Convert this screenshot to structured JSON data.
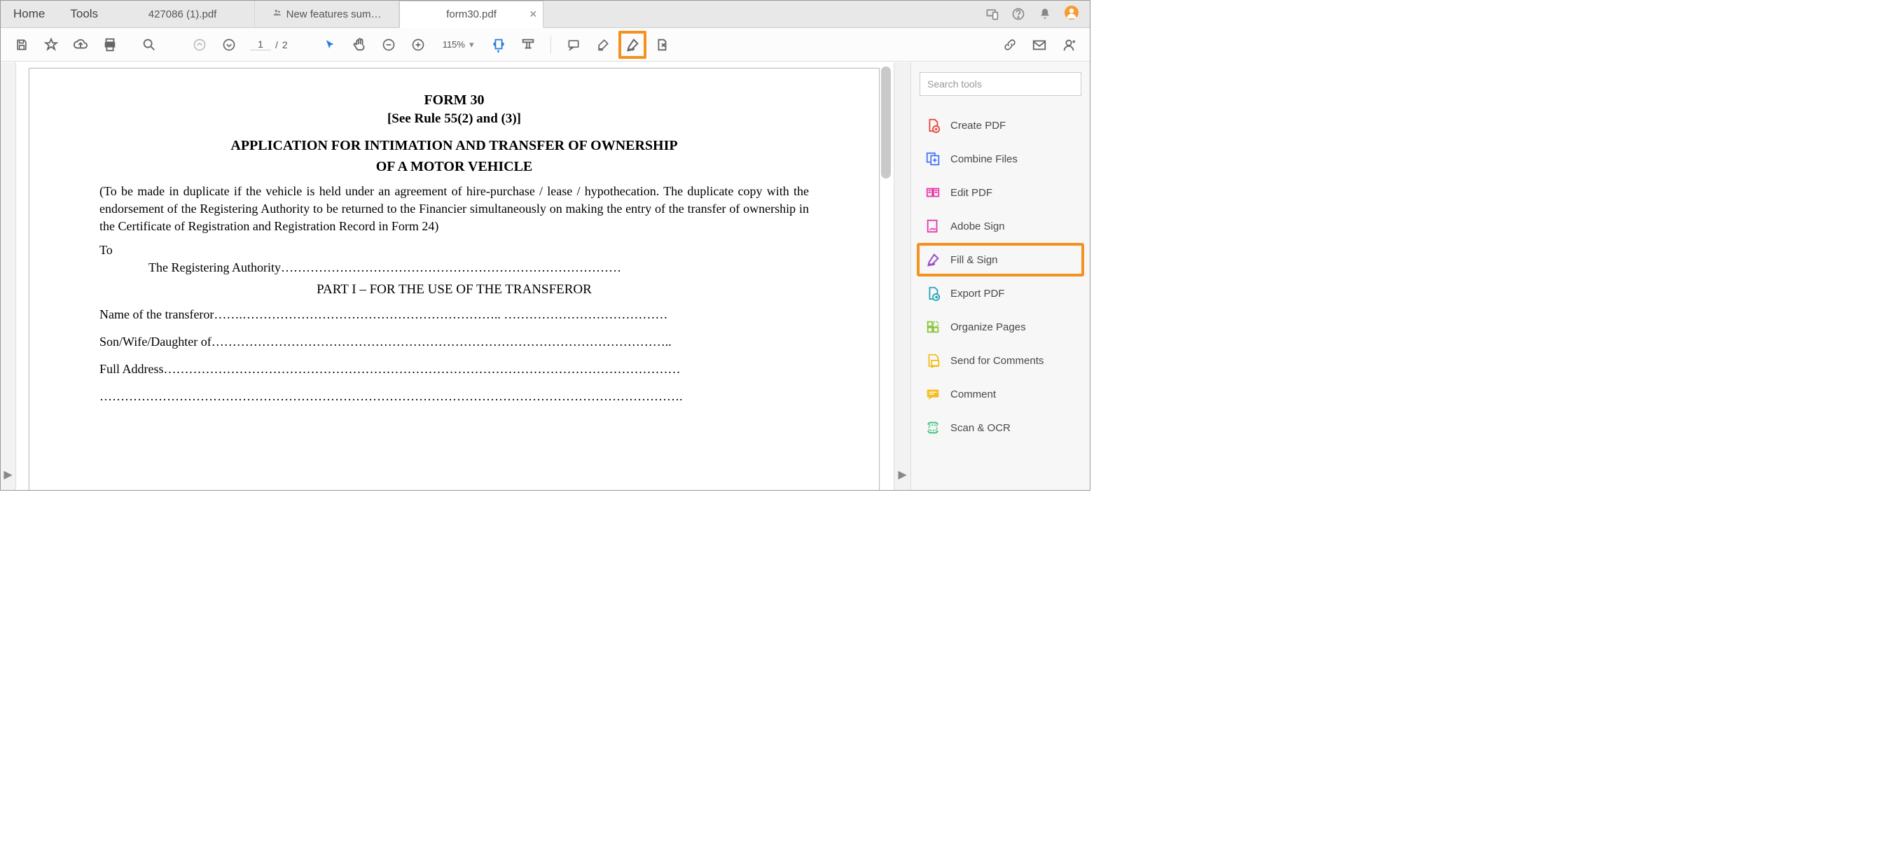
{
  "nav": {
    "home": "Home",
    "tools": "Tools"
  },
  "tabs": [
    {
      "label": "427086 (1).pdf",
      "shared": false,
      "active": false
    },
    {
      "label": "New features sum…",
      "shared": true,
      "active": false
    },
    {
      "label": "form30.pdf",
      "shared": false,
      "active": true
    }
  ],
  "toolbar": {
    "page_current": "1",
    "page_sep": "/",
    "page_total": "2",
    "zoom": "115%"
  },
  "document": {
    "title1": "FORM 30",
    "title2": "[See Rule 55(2) and (3)]",
    "title3a": "APPLICATION FOR INTIMATION AND TRANSFER OF OWNERSHIP",
    "title3b": "OF A MOTOR VEHICLE",
    "note": "(To be made in duplicate if the vehicle is held under an agreement of hire-purchase / lease / hypothecation. The duplicate copy with the endorsement of the Registering Authority to be returned to the Financier simultaneously on making the entry of the transfer of ownership in the Certificate of Registration and Registration Record in Form 24)",
    "to": "To",
    "regauth": "The Registering Authority………………………………………………………………………",
    "part": "PART I – FOR THE USE OF THE TRANSFEROR",
    "f1": "Name of the transferor…….……………………………………………………..   …………………………………",
    "f2": "Son/Wife/Daughter of………………………………………………………………………………………………..",
    "f3": "Full Address……………………………………………………………………………………………………………",
    "f4": "…………………………………………………………………………………………………………………………."
  },
  "sidebar": {
    "search_placeholder": "Search tools",
    "items": [
      {
        "label": "Create PDF",
        "color": "#e8443a"
      },
      {
        "label": "Combine Files",
        "color": "#4a74ff"
      },
      {
        "label": "Edit PDF",
        "color": "#e83aa8"
      },
      {
        "label": "Adobe Sign",
        "color": "#e83aa8"
      },
      {
        "label": "Fill & Sign",
        "color": "#9b4dca",
        "highlighted": true
      },
      {
        "label": "Export PDF",
        "color": "#2aa3b8"
      },
      {
        "label": "Organize Pages",
        "color": "#8cc63f"
      },
      {
        "label": "Send for Comments",
        "color": "#f5bd1f"
      },
      {
        "label": "Comment",
        "color": "#f5bd1f"
      },
      {
        "label": "Scan & OCR",
        "color": "#3ac17a"
      }
    ]
  }
}
